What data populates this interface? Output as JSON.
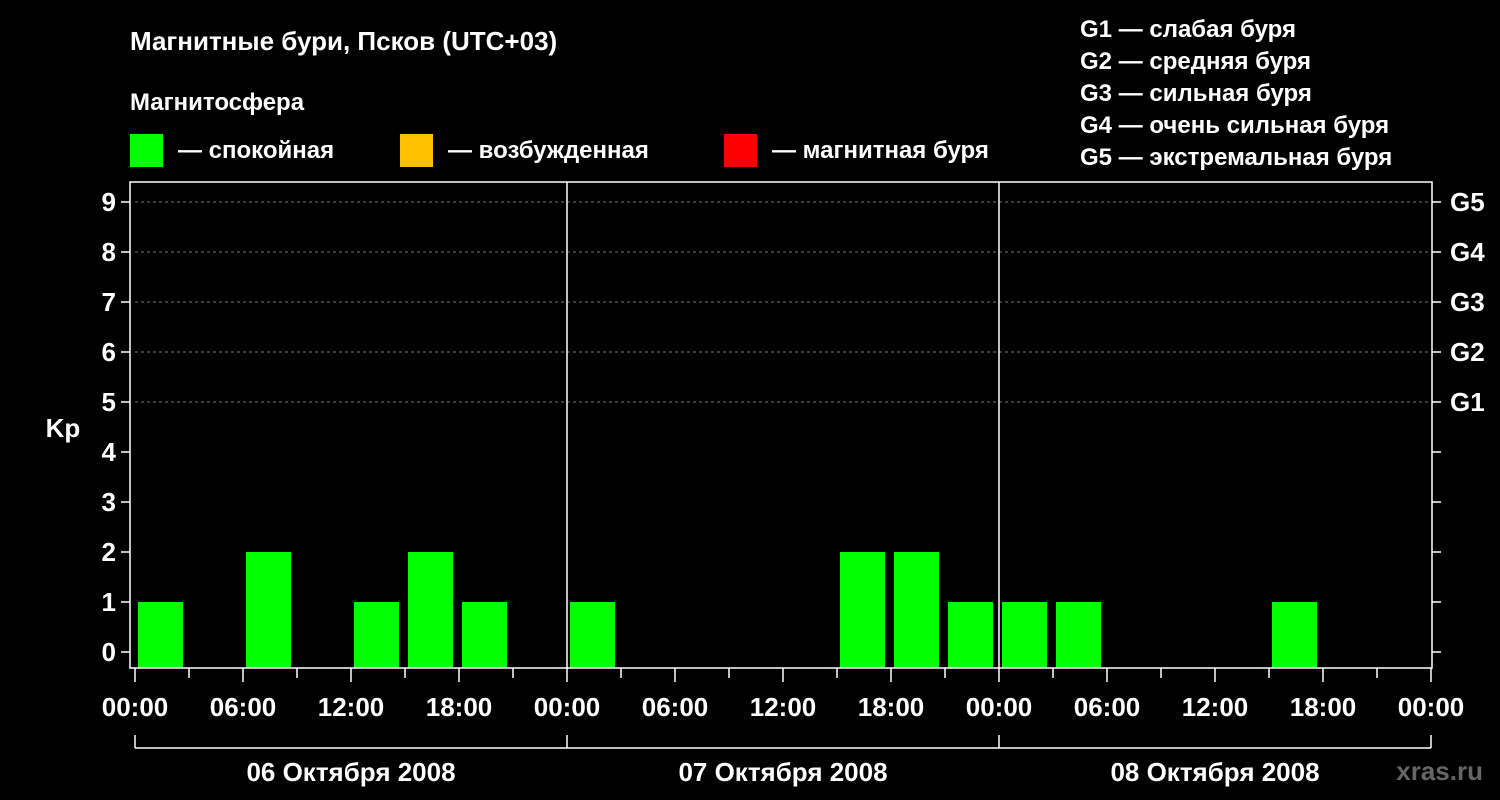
{
  "chart_data": {
    "type": "bar",
    "title": "Магнитные бури, Псков (UTC+03)",
    "legend_title": "Магнитосфера",
    "legend": [
      {
        "label": "— спокойная",
        "color": "#00ff00"
      },
      {
        "label": "— возбужденная",
        "color": "#ffc000"
      },
      {
        "label": "— магнитная буря",
        "color": "#ff0000"
      }
    ],
    "g_scale": [
      "G1 — слабая буря",
      "G2 — средняя буря",
      "G3 — сильная буря",
      "G4 — очень сильная буря",
      "G5 — экстремальная буря"
    ],
    "ylabel": "Kp",
    "ylim": [
      0,
      9
    ],
    "y_ticks": [
      0,
      1,
      2,
      3,
      4,
      5,
      6,
      7,
      8,
      9
    ],
    "right_ticks": [
      {
        "value": 5,
        "label": "G1"
      },
      {
        "value": 6,
        "label": "G2"
      },
      {
        "value": 7,
        "label": "G3"
      },
      {
        "value": 8,
        "label": "G4"
      },
      {
        "value": 9,
        "label": "G5"
      }
    ],
    "x_tick_labels": [
      "00:00",
      "06:00",
      "12:00",
      "18:00",
      "00:00",
      "06:00",
      "12:00",
      "18:00",
      "00:00",
      "06:00",
      "12:00",
      "18:00",
      "00:00"
    ],
    "days": [
      "06 Октября 2008",
      "07 Октября 2008",
      "08 Октября 2008"
    ],
    "interval_hours": 3,
    "series": [
      {
        "color": "#00ff00",
        "values": [
          1,
          0,
          2,
          0,
          1,
          2,
          1,
          0,
          1,
          0,
          0,
          0,
          0,
          2,
          2,
          1,
          1,
          1,
          0,
          0,
          0,
          1,
          0,
          0
        ]
      }
    ],
    "grid": true,
    "grid_lines_at": [
      5,
      6,
      7,
      8,
      9
    ]
  },
  "watermark": "xras.ru"
}
